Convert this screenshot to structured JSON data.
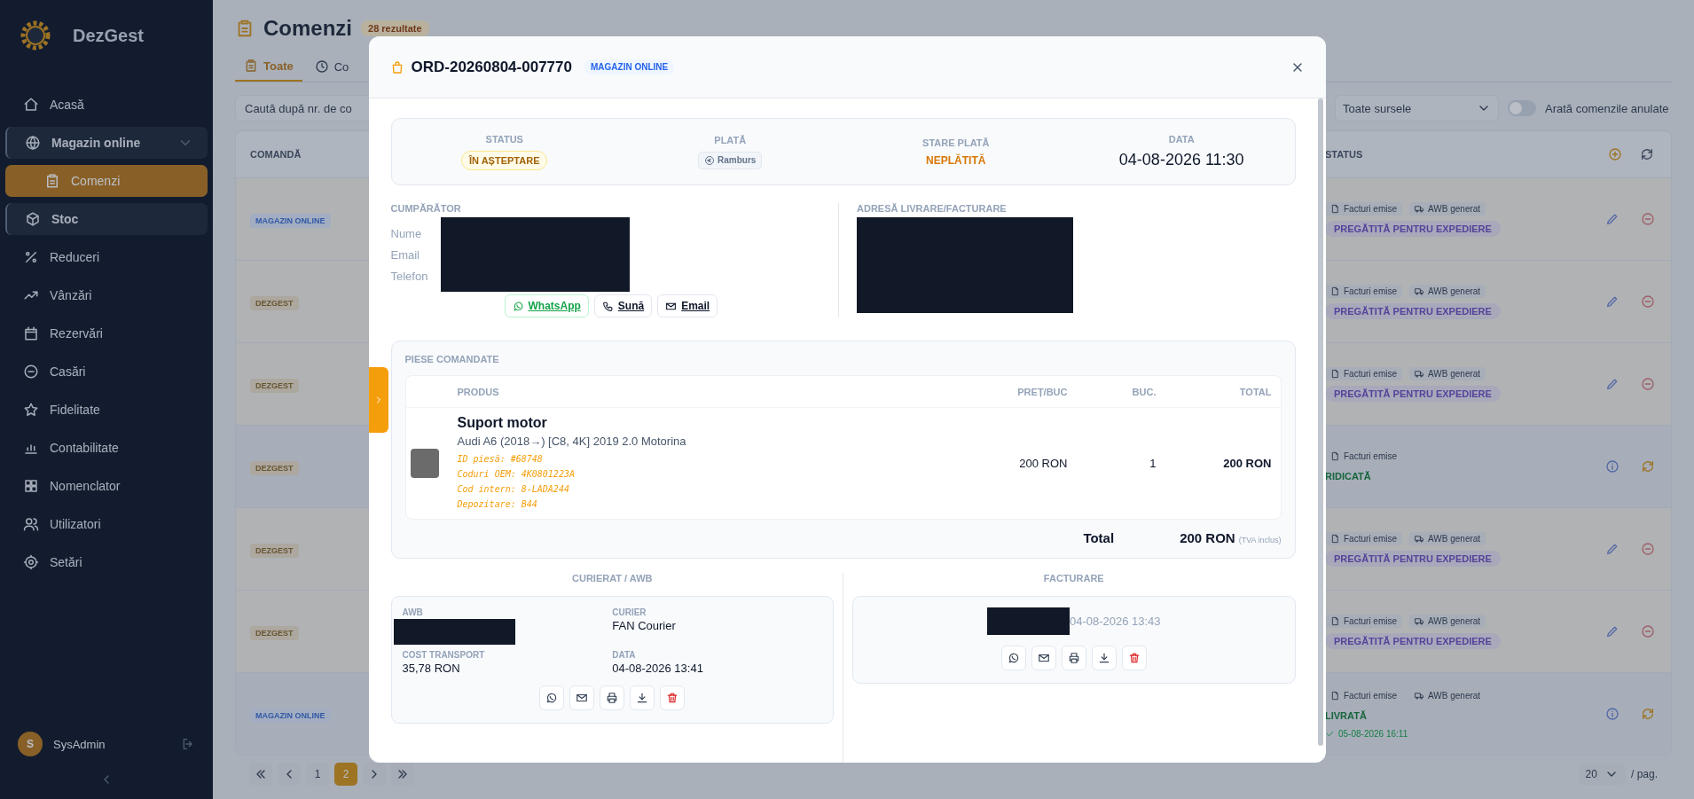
{
  "sidebar": {
    "brand": "DezGest",
    "items": [
      {
        "label": "Acasă",
        "selected": false,
        "active": false
      },
      {
        "label": "Magazin online",
        "selected": false,
        "active": true,
        "expanded": true,
        "children": [
          {
            "label": "Comenzi",
            "selected": true,
            "active": false
          }
        ]
      },
      {
        "label": "Stoc",
        "selected": false,
        "active": true
      },
      {
        "label": "Reduceri",
        "selected": false,
        "active": false
      },
      {
        "label": "Vânzări",
        "selected": false,
        "active": false
      },
      {
        "label": "Rezervări",
        "selected": false,
        "active": false
      },
      {
        "label": "Casări",
        "selected": false,
        "active": false
      },
      {
        "label": "Fidelitate",
        "selected": false,
        "active": false
      },
      {
        "label": "Contabilitate",
        "selected": false,
        "active": false
      },
      {
        "label": "Nomenclator",
        "selected": false,
        "active": false
      },
      {
        "label": "Utilizatori",
        "selected": false,
        "active": false
      },
      {
        "label": "Setări",
        "selected": false,
        "active": false
      }
    ],
    "user": {
      "initial": "S",
      "name": "SysAdmin"
    }
  },
  "page": {
    "title": "Comenzi",
    "count": "28 rezultate",
    "tabs": [
      {
        "label": "Toate",
        "selected": true
      },
      {
        "label": "Co",
        "selected": false
      }
    ],
    "search": {
      "placeholder": "Caută după nr. de co"
    },
    "source_filter": "Toate sursele",
    "show_cancelled": {
      "label": "Arată comenzile anulate",
      "on": false
    },
    "table": {
      "columns": [
        "COMANDĂ",
        "STATUS"
      ],
      "rows": [
        {
          "source": {
            "label": "MAGAZIN ONLINE",
            "kind": "online"
          },
          "chips": [
            "Facturi emise",
            "AWB generat"
          ],
          "status": {
            "label": "PREGĂTITĂ PENTRU EXPEDIERE",
            "kind": "prepared"
          },
          "editable": true
        },
        {
          "source": {
            "label": "DEZGEST",
            "kind": "internal"
          },
          "chips": [
            "Facturi emise",
            "AWB generat"
          ],
          "status": {
            "label": "PREGĂTITĂ PENTRU EXPEDIERE",
            "kind": "prepared"
          },
          "editable": true
        },
        {
          "source": {
            "label": "DEZGEST",
            "kind": "internal"
          },
          "chips": [
            "Facturi emise",
            "AWB generat"
          ],
          "status": {
            "label": "PREGĂTITĂ PENTRU EXPEDIERE",
            "kind": "prepared"
          },
          "editable": true
        },
        {
          "source": {
            "label": "DEZGEST",
            "kind": "internal"
          },
          "chips": [
            "Facturi emise"
          ],
          "status": {
            "label": "RIDICATĂ",
            "kind": "done"
          },
          "editable": false
        },
        {
          "source": {
            "label": "DEZGEST",
            "kind": "internal"
          },
          "chips": [
            "Facturi emise",
            "AWB generat"
          ],
          "status": {
            "label": "PREGĂTITĂ PENTRU EXPEDIERE",
            "kind": "prepared"
          },
          "editable": true
        },
        {
          "source": {
            "label": "DEZGEST",
            "kind": "internal"
          },
          "chips": [
            "Facturi emise",
            "AWB generat"
          ],
          "status": {
            "label": "PREGĂTITĂ PENTRU EXPEDIERE",
            "kind": "prepared"
          },
          "editable": true
        },
        {
          "source": {
            "label": "MAGAZIN ONLINE",
            "kind": "online"
          },
          "chips": [
            "Facturi emise",
            "AWB generat"
          ],
          "status": {
            "label": "LIVRATĂ",
            "kind": "done"
          },
          "delivered_at": "05-08-2026 16:11",
          "editable": false
        }
      ]
    },
    "pagination": {
      "pages": [
        {
          "label": "1",
          "selected": false
        },
        {
          "label": "2",
          "selected": true
        }
      ],
      "per_page": "20",
      "per_page_suffix": "/ pag."
    }
  },
  "order": {
    "number": "ORD-20260804-007770",
    "source": "MAGAZIN ONLINE",
    "summary": [
      {
        "label": "STATUS",
        "value": "ÎN AȘTEPTARE",
        "kind": "status"
      },
      {
        "label": "PLATĂ",
        "value": "Ramburs",
        "kind": "payment"
      },
      {
        "label": "STARE PLATĂ",
        "value": "NEPLĂTITĂ",
        "kind": "payment_state"
      },
      {
        "label": "DATA",
        "value": "04-08-2026 11:30",
        "kind": "date"
      }
    ],
    "buyer": {
      "heading": "CUMPĂRĂTOR",
      "fields": [
        "Nume",
        "Email",
        "Telefon"
      ],
      "redacted": true,
      "actions": [
        {
          "label": "WhatsApp",
          "kind": "whatsapp"
        },
        {
          "label": "Sună",
          "kind": "phone"
        },
        {
          "label": "Email",
          "kind": "email"
        }
      ]
    },
    "address": {
      "heading": "ADRESĂ LIVRARE/FACTURARE",
      "redacted": true
    },
    "parts": {
      "heading": "PIESE COMANDATE",
      "columns": [
        "PRODUS",
        "PREȚ/BUC",
        "BUC.",
        "TOTAL"
      ],
      "rows": [
        {
          "name": "Suport motor",
          "vehicle": "Audi A6 (2018→) [C8, 4K] 2019 2.0 Motorina",
          "details": [
            "ID piesă: #68748",
            "Coduri OEM: 4K0801223A",
            "Cod intern: 8-LADA244",
            "Depozitare: B44"
          ],
          "price": "200 RON",
          "qty": "1",
          "total": "200 RON"
        }
      ],
      "total_label": "Total",
      "total": "200 RON",
      "total_note": "(TVA inclus)"
    },
    "courier": {
      "heading": "CURIERAT / AWB",
      "fields": [
        {
          "label": "AWB",
          "redacted": true
        },
        {
          "label": "CURIER",
          "value": "FAN Courier",
          "redacted": false
        },
        {
          "label": "COST TRANSPORT",
          "value": "35,78 RON",
          "redacted": false
        },
        {
          "label": "DATA",
          "value": "04-08-2026 13:41",
          "redacted": false
        }
      ],
      "actions": [
        {
          "kind": "whatsapp"
        },
        {
          "kind": "email"
        },
        {
          "kind": "print"
        },
        {
          "kind": "download"
        },
        {
          "kind": "delete"
        }
      ]
    },
    "invoice": {
      "heading": "FACTURARE",
      "redacted": true,
      "date": "04-08-2026 13:43",
      "actions": [
        {
          "kind": "whatsapp"
        },
        {
          "kind": "email"
        },
        {
          "kind": "print"
        },
        {
          "kind": "download"
        },
        {
          "kind": "delete"
        }
      ]
    }
  }
}
